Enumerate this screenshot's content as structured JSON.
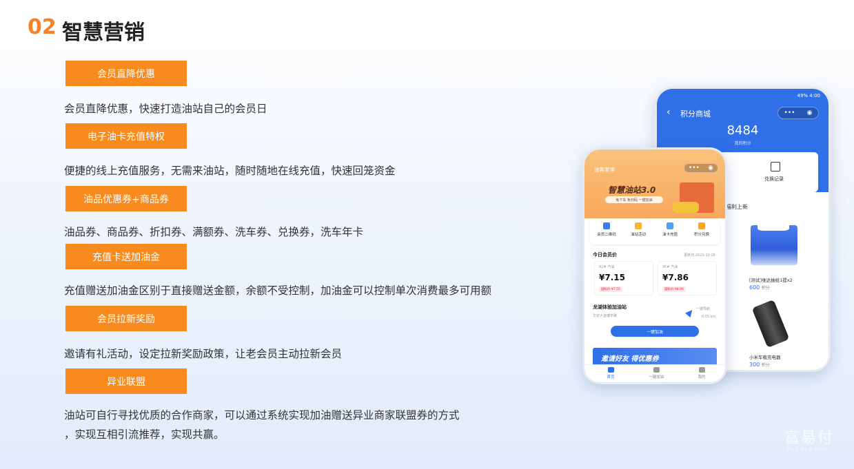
{
  "header": {
    "number": "02",
    "title": "智慧营销"
  },
  "features": [
    {
      "badge": "会员直降优惠",
      "desc": "会员直降优惠，快速打造油站自己的会员日"
    },
    {
      "badge": "电子油卡充值特权",
      "desc": "便捷的线上充值服务，无需来油站，随时随地在线充值，快速回笼资金"
    },
    {
      "badge": "油品优惠券+商品券",
      "desc": "油品券、商品券、折扣券、满额券、洗车券、兑换券，洗车年卡"
    },
    {
      "badge": "充值卡送加油金",
      "desc": "充值赠送加油金区别于直接赠送金额，余额不受控制，加油金可以控制单次消费最多可用额"
    },
    {
      "badge": "会员拉新奖励",
      "desc": "邀请有礼活动，设定拉新奖励政策，让老会员主动拉新会员"
    },
    {
      "badge": "异业联盟",
      "desc": "油站可自行寻找优质的合作商家，可以通过系统实现加油赠送异业商家联盟券的方式",
      "desc2": "，实现互相引流推荐，实现共赢。"
    }
  ],
  "phone_back": {
    "status_right": "49% 4:00",
    "nav_title": "积分商城",
    "points": "8484",
    "points_label": "我的积分",
    "exchange_label": "兑换记录",
    "welfare_title": "福利上新",
    "products": [
      {
        "name": "[测试]维达抽纸1提x2",
        "price": "600",
        "unit": "积分"
      },
      {
        "name": "小米车载充电器",
        "price": "300",
        "unit": "积分"
      }
    ]
  },
  "phone_front": {
    "nav_title": "油客里里",
    "banner_title": "智慧油站3.0",
    "banner_sub": "免下车 免扫码 一键加油",
    "quick_menu": [
      "会员二维码",
      "油站活动",
      "油卡充值",
      "积分兑换"
    ],
    "section_title": "今日会员价",
    "update_time": "更新日:2021-10-26",
    "fuels": [
      {
        "name": "92# 汽油",
        "price": "¥7.15",
        "tag": "国标价 ¥7.55"
      },
      {
        "name": "95# 汽油",
        "price": "¥7.86",
        "tag": "国标价 ¥8.06"
      }
    ],
    "station_name": "龙湖体验加油站",
    "station_addr": "华安大道博学路",
    "nav_label": "一键导航",
    "distance": "0.05 km",
    "refuel_button": "一键加油",
    "invite_banner": "邀请好友 得优惠券",
    "tabs": [
      "首页",
      "一键加油",
      "我的"
    ]
  },
  "watermark": {
    "brand": "富易付",
    "domain": "FuYiPay.com"
  },
  "colors": {
    "accent": "#f88a1e",
    "title_number": "#f5812b",
    "app_blue": "#2f6fe8"
  }
}
